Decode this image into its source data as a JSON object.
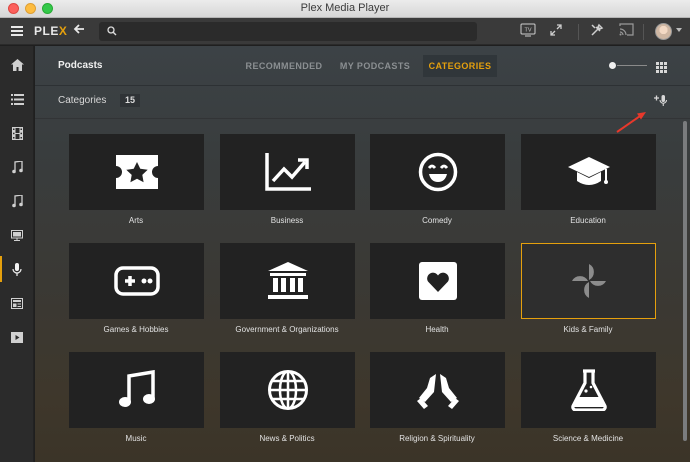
{
  "window": {
    "title": "Plex Media Player"
  },
  "topbar": {
    "logo_main": "PLE",
    "logo_x": "X",
    "search_placeholder": "",
    "tv_label": "TV"
  },
  "sidebar": {
    "items": [
      {
        "icon": "home-icon"
      },
      {
        "icon": "list-icon"
      },
      {
        "icon": "film-icon"
      },
      {
        "icon": "music-note-icon"
      },
      {
        "icon": "music-notes-icon"
      },
      {
        "icon": "monitor-icon"
      },
      {
        "icon": "microphone-icon",
        "active": true
      },
      {
        "icon": "news-icon"
      },
      {
        "icon": "play-icon"
      }
    ]
  },
  "header": {
    "title": "Podcasts",
    "tabs": [
      {
        "label": "RECOMMENDED",
        "active": false
      },
      {
        "label": "MY PODCASTS",
        "active": false
      },
      {
        "label": "CATEGORIES",
        "active": true
      }
    ]
  },
  "subheader": {
    "title": "Categories",
    "count": "15"
  },
  "categories": [
    {
      "label": "Arts",
      "icon": "ticket-star-icon"
    },
    {
      "label": "Business",
      "icon": "chart-up-icon"
    },
    {
      "label": "Comedy",
      "icon": "smile-icon"
    },
    {
      "label": "Education",
      "icon": "graduation-cap-icon"
    },
    {
      "label": "Games & Hobbies",
      "icon": "gamepad-icon"
    },
    {
      "label": "Government & Organizations",
      "icon": "building-columns-icon"
    },
    {
      "label": "Health",
      "icon": "heart-icon"
    },
    {
      "label": "Kids & Family",
      "icon": "pinwheel-icon",
      "selected": true
    },
    {
      "label": "Music",
      "icon": "music-note-icon"
    },
    {
      "label": "News & Politics",
      "icon": "globe-icon"
    },
    {
      "label": "Religion & Spirituality",
      "icon": "praying-hands-icon"
    },
    {
      "label": "Science & Medicine",
      "icon": "flask-icon"
    }
  ],
  "colors": {
    "accent": "#e5a00d",
    "annotation_arrow": "#e8382b"
  }
}
